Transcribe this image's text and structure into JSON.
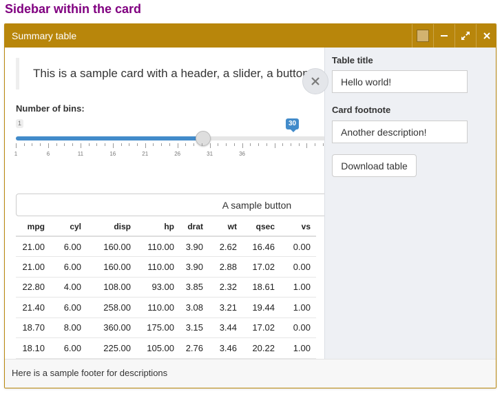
{
  "page": {
    "title": "Sidebar within the card"
  },
  "card": {
    "header_title": "Summary table",
    "toolbar": {
      "swatch_color": "#d2b270",
      "icons": [
        "color-swatch-icon",
        "minimize-icon",
        "expand-icon",
        "close-icon"
      ]
    },
    "accent_color": "#b8860b",
    "footer_text": "Here is a sample footer for descriptions"
  },
  "main": {
    "blockquote": "This is a sample card with a header, a slider, a button, a table and a footer.",
    "slider": {
      "label": "Number of bins:",
      "min": 1,
      "max": 50,
      "value": 30,
      "min_label": "1",
      "value_label": "30",
      "tick_labels": [
        "1",
        "6",
        "11",
        "16",
        "21",
        "26",
        "31",
        "36"
      ]
    },
    "sample_button_label": "A sample button",
    "table": {
      "columns": [
        "mpg",
        "cyl",
        "disp",
        "hp",
        "drat",
        "wt",
        "qsec",
        "vs"
      ],
      "rows": [
        [
          "21.00",
          "6.00",
          "160.00",
          "110.00",
          "3.90",
          "2.62",
          "16.46",
          "0.00"
        ],
        [
          "21.00",
          "6.00",
          "160.00",
          "110.00",
          "3.90",
          "2.88",
          "17.02",
          "0.00"
        ],
        [
          "22.80",
          "4.00",
          "108.00",
          "93.00",
          "3.85",
          "2.32",
          "18.61",
          "1.00"
        ],
        [
          "21.40",
          "6.00",
          "258.00",
          "110.00",
          "3.08",
          "3.21",
          "19.44",
          "1.00"
        ],
        [
          "18.70",
          "8.00",
          "360.00",
          "175.00",
          "3.15",
          "3.44",
          "17.02",
          "0.00"
        ],
        [
          "18.10",
          "6.00",
          "225.00",
          "105.00",
          "2.76",
          "3.46",
          "20.22",
          "1.00"
        ]
      ]
    }
  },
  "sidebar": {
    "table_title_label": "Table title",
    "table_title_value": "Hello world!",
    "footnote_label": "Card footnote",
    "footnote_value": "Another description!",
    "download_label": "Download table",
    "toggle_icon": "close-icon"
  }
}
